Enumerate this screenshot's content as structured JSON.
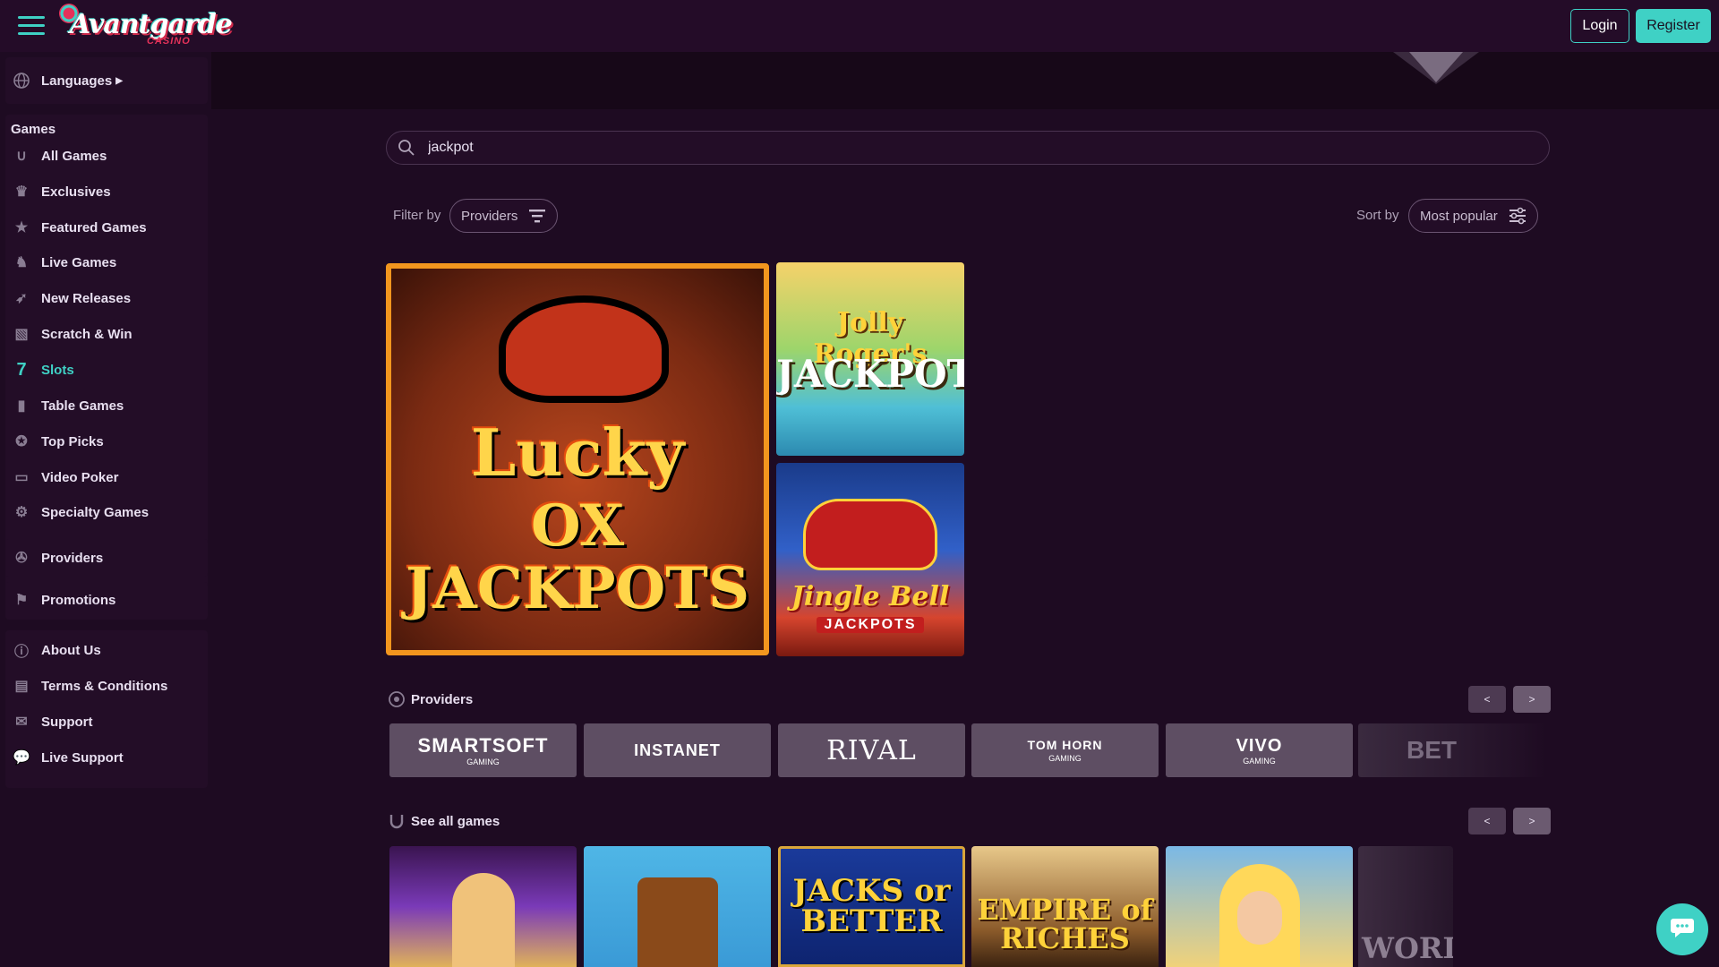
{
  "header": {
    "logo_text": "Avantgarde",
    "logo_sub": "CASINO",
    "login_label": "Login",
    "register_label": "Register"
  },
  "sidebar": {
    "languages_label": "Languages",
    "games_heading": "Games",
    "items": [
      {
        "label": "All Games",
        "icon": "horseshoe-icon"
      },
      {
        "label": "Exclusives",
        "icon": "crown-icon"
      },
      {
        "label": "Featured Games",
        "icon": "star-icon"
      },
      {
        "label": "Live Games",
        "icon": "dealer-icon"
      },
      {
        "label": "New Releases",
        "icon": "rocket-icon"
      },
      {
        "label": "Scratch & Win",
        "icon": "scratch-card-icon"
      },
      {
        "label": "Slots",
        "icon": "seven-icon"
      },
      {
        "label": "Table Games",
        "icon": "card-icon"
      },
      {
        "label": "Top Picks",
        "icon": "award-icon"
      },
      {
        "label": "Video Poker",
        "icon": "monitor-icon"
      },
      {
        "label": "Specialty Games",
        "icon": "gear-icon"
      }
    ],
    "providers_label": "Providers",
    "promotions_label": "Promotions",
    "info_items": [
      {
        "label": "About Us",
        "icon": "info-icon"
      },
      {
        "label": "Terms & Conditions",
        "icon": "document-icon"
      },
      {
        "label": "Support",
        "icon": "mail-icon"
      },
      {
        "label": "Live Support",
        "icon": "chat-icon"
      }
    ]
  },
  "search": {
    "value": "jackpot"
  },
  "filters": {
    "filter_label": "Filter by",
    "providers_pill": "Providers",
    "sort_label": "Sort by",
    "sort_value": "Most popular"
  },
  "results": [
    {
      "title_line1": "Lucky",
      "title_line2": "OX",
      "title_line3": "JACKPOTS"
    },
    {
      "title_line1": "Jolly Roger's",
      "title_line2": "JACKPOT!"
    },
    {
      "title_line1": "Jingle Bell",
      "title_line2": "JACKPOTS"
    }
  ],
  "providers_section": {
    "title": "Providers",
    "prev": "<",
    "next": ">",
    "items": [
      {
        "name": "SMARTSOFT",
        "sub": "GAMING"
      },
      {
        "name": "INSTANET",
        "sub": ""
      },
      {
        "name": "RIVAL",
        "sub": ""
      },
      {
        "name": "TOM HORN",
        "sub": "GAMING"
      },
      {
        "name": "VIVO",
        "sub": "GAMING"
      }
    ],
    "faded_item": "BET"
  },
  "all_games_section": {
    "title": "See all games",
    "prev": "<",
    "next": ">",
    "items": [
      {
        "title": ""
      },
      {
        "title": ""
      },
      {
        "title": "JACKS or BETTER"
      },
      {
        "title": "EMPIRE of RICHES"
      },
      {
        "title": ""
      },
      {
        "title": "WORL"
      }
    ]
  },
  "colors": {
    "accent": "#3fd1c5",
    "background": "#1e0b22",
    "sidebar_block": "#230d27"
  }
}
